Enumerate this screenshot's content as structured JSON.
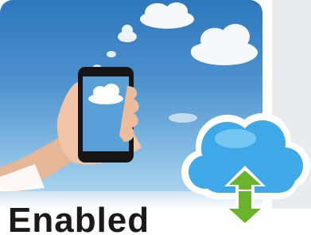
{
  "photo": {
    "icon": "hand-holding-phone-clouds"
  },
  "badge": {
    "icon": "cloud-sync-icon",
    "cloud_color": "#3fa9e8",
    "arrow_color": "#6ab42d"
  },
  "caption": {
    "text": "Enabled"
  }
}
